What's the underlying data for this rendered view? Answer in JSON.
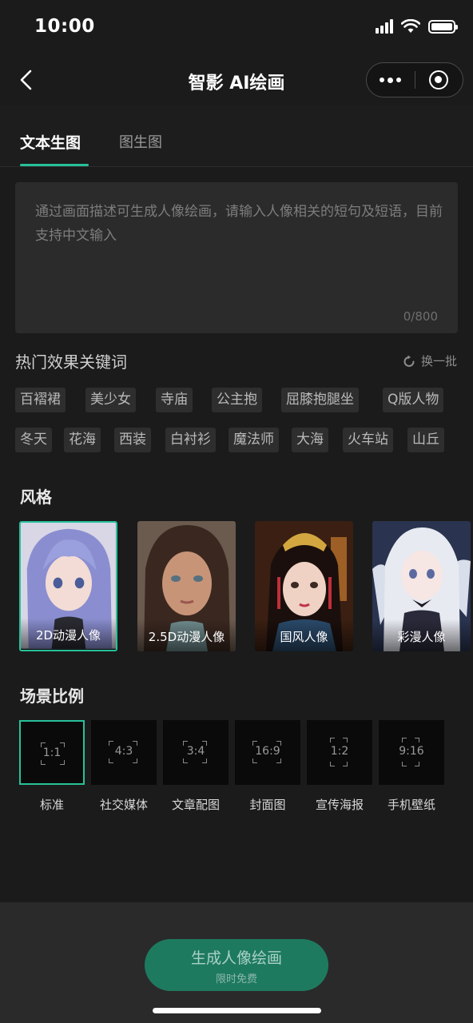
{
  "status_bar": {
    "time": "10:00"
  },
  "nav": {
    "title": "智影 AI绘画",
    "back_icon": "chevron-left-icon",
    "more_icon": "more-dots-icon",
    "close_icon": "target-circle-icon"
  },
  "tabs": [
    {
      "label": "文本生图",
      "active": true
    },
    {
      "label": "图生图",
      "active": false
    }
  ],
  "prompt": {
    "placeholder": "通过画面描述可生成人像绘画，请输入人像相关的短句及短语，目前支持中文输入",
    "value": "",
    "counter": "0/800"
  },
  "hot_keywords": {
    "title": "热门效果关键词",
    "refresh_label": "换一批",
    "rows": [
      [
        "百褶裙",
        "美少女",
        "寺庙",
        "公主抱",
        "屈膝抱腿坐",
        "Q版人物"
      ],
      [
        "冬天",
        "花海",
        "西装",
        "白衬衫",
        "魔法师",
        "大海",
        "火车站",
        "山丘"
      ]
    ]
  },
  "styles": {
    "title": "风格",
    "items": [
      {
        "label": "2D动漫人像",
        "selected": true
      },
      {
        "label": "2.5D动漫人像",
        "selected": false
      },
      {
        "label": "国风人像",
        "selected": false
      },
      {
        "label": "彩漫人像",
        "selected": false
      }
    ]
  },
  "ratios": {
    "title": "场景比例",
    "items": [
      {
        "ratio": "1:1",
        "label": "标准",
        "selected": true
      },
      {
        "ratio": "4:3",
        "label": "社交媒体",
        "selected": false
      },
      {
        "ratio": "3:4",
        "label": "文章配图",
        "selected": false
      },
      {
        "ratio": "16:9",
        "label": "封面图",
        "selected": false
      },
      {
        "ratio": "1:2",
        "label": "宣传海报",
        "selected": false
      },
      {
        "ratio": "9:16",
        "label": "手机壁纸",
        "selected": false
      }
    ]
  },
  "generate": {
    "label": "生成人像绘画",
    "sublabel": "限时免费"
  },
  "colors": {
    "accent": "#27c199",
    "background": "#1b1b1b",
    "button": "#1e7a5f"
  }
}
